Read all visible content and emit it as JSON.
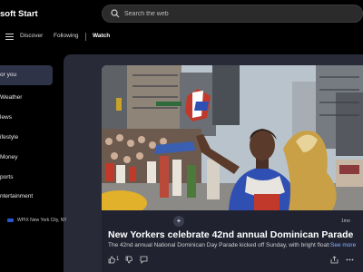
{
  "app": {
    "title": "soft Start"
  },
  "search": {
    "placeholder": "Search the web"
  },
  "nav": {
    "tabs": [
      {
        "label": "Discover"
      },
      {
        "label": "Following"
      },
      {
        "label": "Watch"
      }
    ]
  },
  "sidebar": {
    "items": [
      {
        "label": "or you"
      },
      {
        "label": "Weather"
      },
      {
        "label": "lews"
      },
      {
        "label": "ifestyle"
      },
      {
        "label": "Money"
      },
      {
        "label": "ports"
      },
      {
        "label": "ntertainment"
      }
    ]
  },
  "card": {
    "source": "WPIX New York City, NY",
    "age": "1mo",
    "headline": "New Yorkers celebrate 42nd annual Dominican Parade",
    "summary": "The 42nd annual National Dominican Day Parade kicked off Sunday, with bright floats...",
    "see_more": "See more",
    "like_count": "1"
  },
  "colors": {
    "background": "#000000",
    "panel": "#282a37",
    "card": "#202230",
    "link": "#8ab4ff",
    "sidebar_active": "#2f3347"
  }
}
